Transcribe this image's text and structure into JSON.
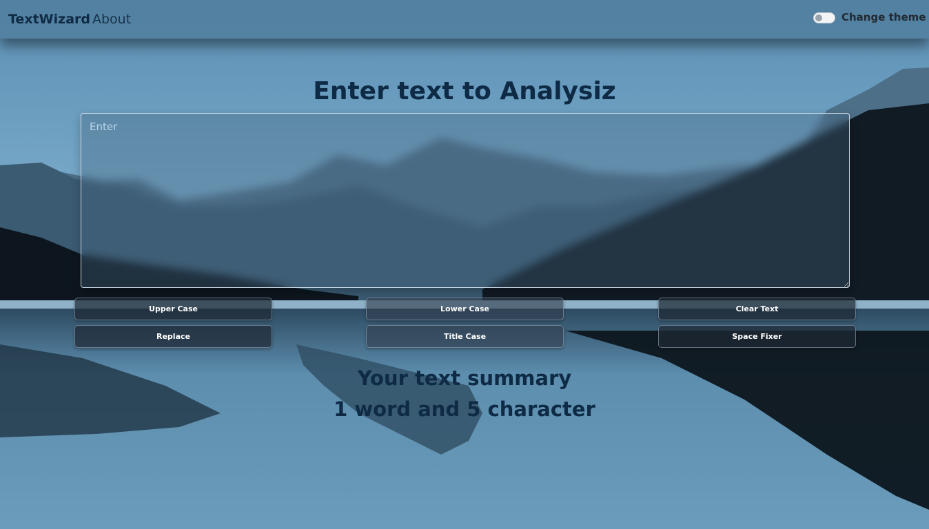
{
  "navbar": {
    "brand": "TextWizard",
    "about_link": "About",
    "theme_toggle_label": "Change theme"
  },
  "main": {
    "heading": "Enter text to Analysiz",
    "textarea": {
      "placeholder": "Enter",
      "value": ""
    },
    "buttons": {
      "upper_case": "Upper Case",
      "lower_case": "Lower Case",
      "clear_text": "Clear Text",
      "replace": "Replace",
      "title_case": "Title Case",
      "space_fixer": "Space Fixer"
    },
    "summary": {
      "title": "Your text summary",
      "count_text": "1 word and 5 character"
    }
  },
  "colors": {
    "navbar_bg": "#5380a0",
    "heading_text": "#0e2a45",
    "button_bg": "#1e2834",
    "button_text": "#ffffff"
  },
  "icons": {
    "theme_toggle": "toggle-switch-icon"
  }
}
